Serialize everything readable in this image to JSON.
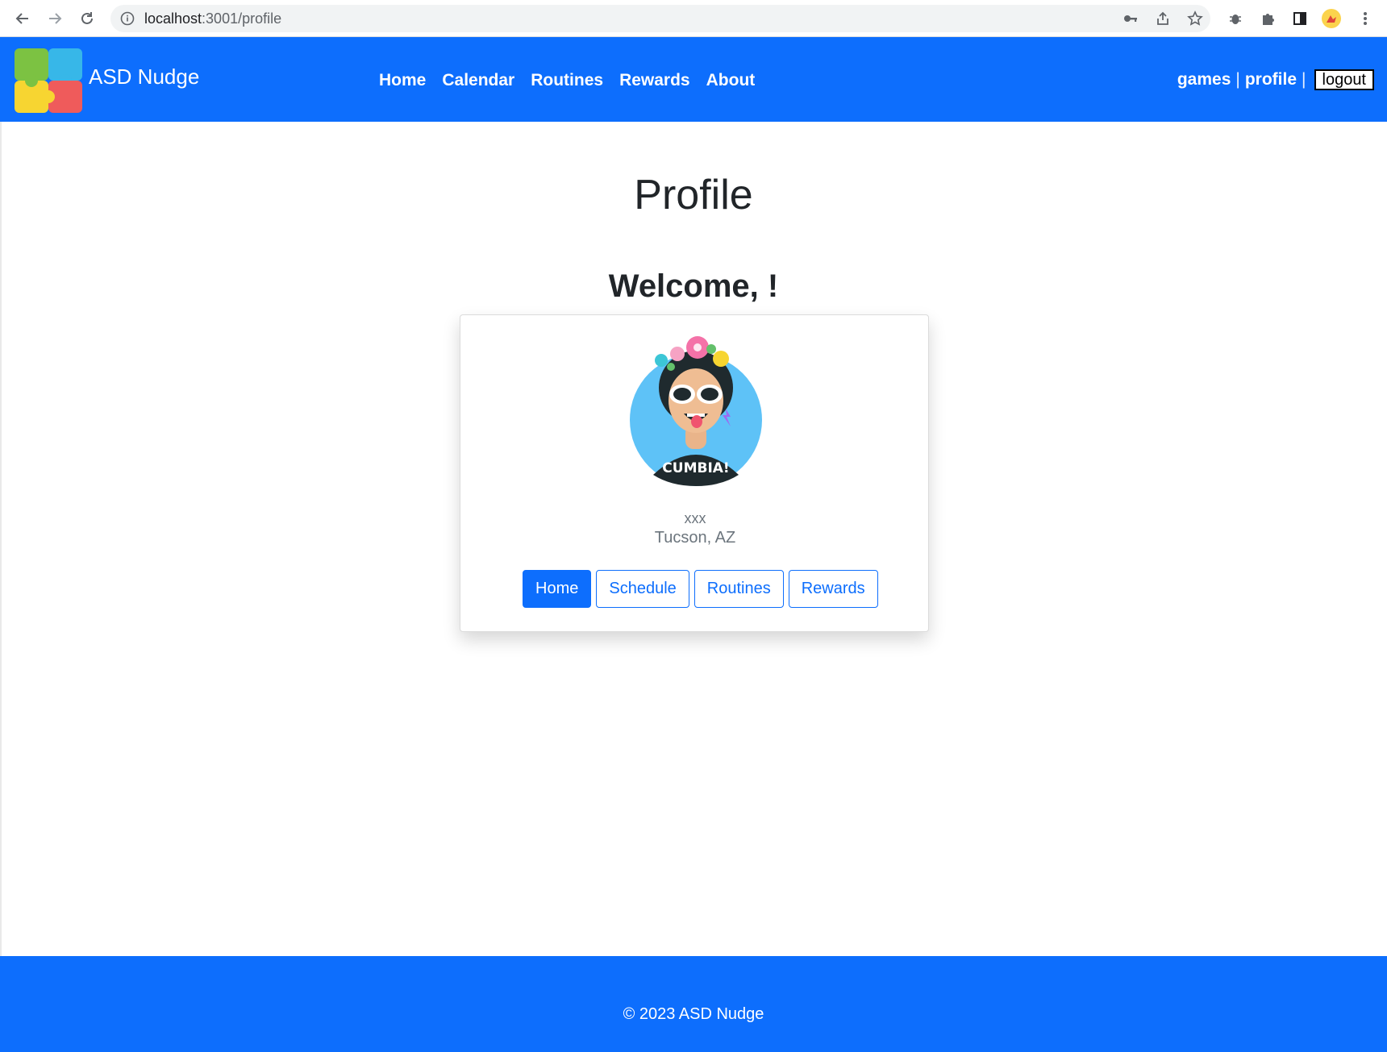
{
  "browser": {
    "url_host": "localhost",
    "url_path": ":3001/profile"
  },
  "navbar": {
    "brand": "ASD Nudge",
    "links": [
      "Home",
      "Calendar",
      "Routines",
      "Rewards",
      "About"
    ],
    "right_links": {
      "games": "games",
      "profile": "profile",
      "separator": "|",
      "logout": "logout"
    }
  },
  "main": {
    "title": "Profile",
    "welcome": "Welcome, !",
    "card": {
      "avatar_text": "CUMBIA!",
      "name": "xxx",
      "location": "Tucson, AZ",
      "buttons": [
        "Home",
        "Schedule",
        "Routines",
        "Rewards"
      ]
    }
  },
  "footer": {
    "text": "© 2023 ASD Nudge"
  },
  "colors": {
    "primary": "#0d6efd",
    "avatar_bg": "#5ec2f7",
    "muted_text": "#6c757d"
  }
}
